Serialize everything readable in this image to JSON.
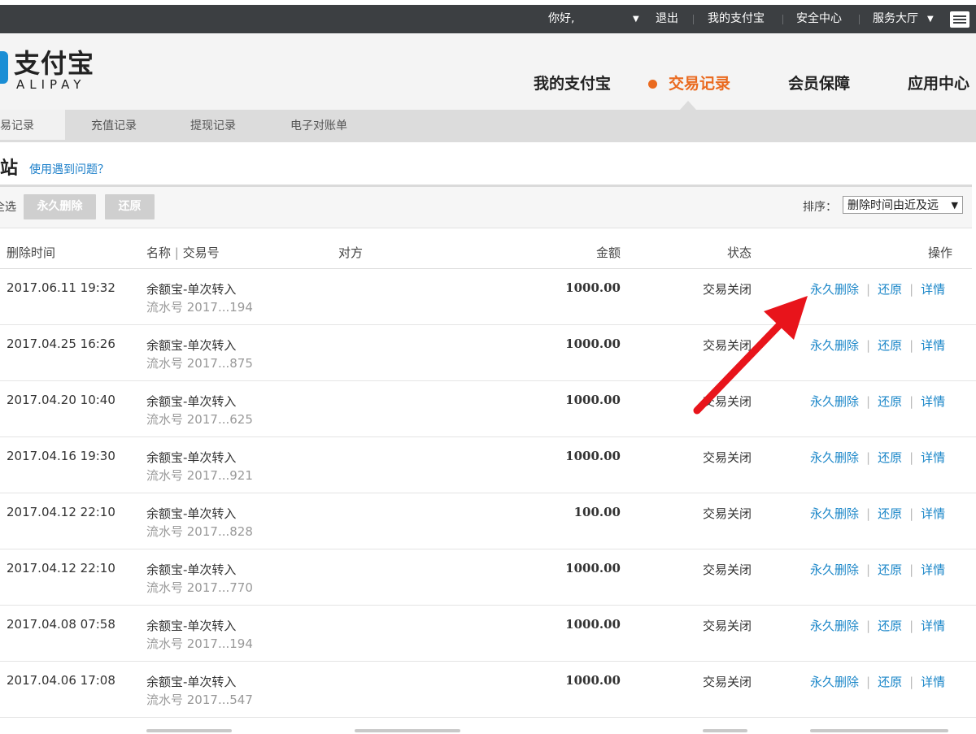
{
  "topbar": {
    "greeting": "你好,",
    "logout": "退出",
    "my_alipay": "我的支付宝",
    "security_center": "安全中心",
    "service_hall": "服务大厅",
    "menu_icon": "list-menu-icon"
  },
  "logo": {
    "cn": "支付宝",
    "en": "ALIPAY"
  },
  "main_nav": {
    "items": [
      "我的支付宝",
      "交易记录",
      "会员保障",
      "应用中心"
    ],
    "active_index": 1,
    "active_color": "#ea6a1f"
  },
  "sub_nav": {
    "items": [
      "交易记录",
      "充值记录",
      "提现记录",
      "电子对账单"
    ],
    "active_index": 0
  },
  "page": {
    "title": "回收站",
    "help_link": "使用遇到问题？"
  },
  "toolbar": {
    "select_all": "全选",
    "delete_button": "永久删除",
    "restore_button": "还原",
    "sort_label": "排序：",
    "sort_value": "删除时间由近及远"
  },
  "table": {
    "headers": {
      "time": "删除时间",
      "name": "名称",
      "name_sep": "|",
      "trade_no": "交易号",
      "counterparty": "对方",
      "amount": "金额",
      "status": "状态",
      "ops": "操作"
    },
    "rows": [
      {
        "time": "2017.06.11 19:32",
        "name": "余额宝-单次转入",
        "serial": "流水号 2017...194",
        "amount": "1000.00",
        "status": "交易关闭"
      },
      {
        "time": "2017.04.25 16:26",
        "name": "余额宝-单次转入",
        "serial": "流水号 2017...875",
        "amount": "1000.00",
        "status": "交易关闭"
      },
      {
        "time": "2017.04.20 10:40",
        "name": "余额宝-单次转入",
        "serial": "流水号 2017...625",
        "amount": "1000.00",
        "status": "交易关闭"
      },
      {
        "time": "2017.04.16 19:30",
        "name": "余额宝-单次转入",
        "serial": "流水号 2017...921",
        "amount": "1000.00",
        "status": "交易关闭"
      },
      {
        "time": "2017.04.12 22:10",
        "name": "余额宝-单次转入",
        "serial": "流水号 2017...828",
        "amount": "100.00",
        "status": "交易关闭"
      },
      {
        "time": "2017.04.12 22:10",
        "name": "余额宝-单次转入",
        "serial": "流水号 2017...770",
        "amount": "1000.00",
        "status": "交易关闭"
      },
      {
        "time": "2017.04.08 07:58",
        "name": "余额宝-单次转入",
        "serial": "流水号 2017...194",
        "amount": "1000.00",
        "status": "交易关闭"
      },
      {
        "time": "2017.04.06 17:08",
        "name": "余额宝-单次转入",
        "serial": "流水号 2017...547",
        "amount": "1000.00",
        "status": "交易关闭"
      }
    ],
    "ops": {
      "delete": "永久删除",
      "restore": "还原",
      "detail": "详情",
      "separator": "|"
    }
  },
  "annotation": {
    "arrow_color": "#e8141b",
    "points_to": "永久删除"
  }
}
